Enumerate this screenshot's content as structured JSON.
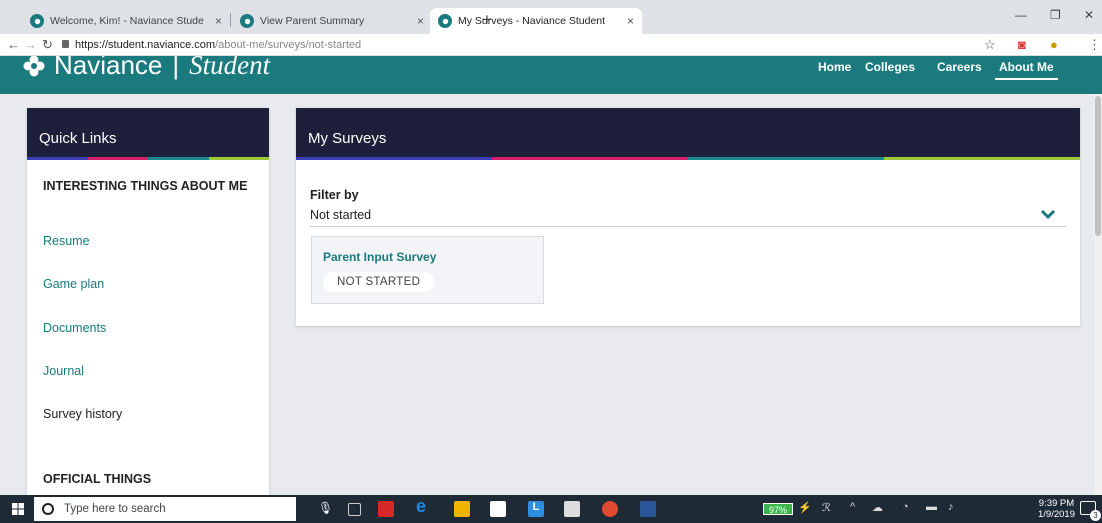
{
  "browser": {
    "tabs": [
      {
        "label": "Welcome, Kim! - Naviance Stude",
        "close": "×"
      },
      {
        "label": "View Parent Summary",
        "close": "×"
      },
      {
        "label": "My Surveys - Naviance Student",
        "close": "×"
      }
    ],
    "new_tab": "+",
    "url_host": "https://student.naviance.com",
    "url_path": "/about-me/surveys/not-started"
  },
  "site": {
    "brand_name": "Naviance",
    "brand_sep": "|",
    "brand_product": "Student",
    "nav": [
      "Home",
      "Colleges",
      "Careers",
      "About Me"
    ],
    "active_nav": "About Me",
    "accent": "#1a7a7e",
    "card_header_bg": "#1d1f3b"
  },
  "sidebar": {
    "title": "Quick Links",
    "section1": "INTERESTING THINGS ABOUT ME",
    "links": [
      "Resume",
      "Game plan",
      "Documents",
      "Journal",
      "Survey history"
    ],
    "section2": "OFFICIAL THINGS"
  },
  "main": {
    "title": "My Surveys",
    "filter_label": "Filter by",
    "filter_value": "Not started",
    "surveys": [
      {
        "title": "Parent Input Survey",
        "status": "NOT STARTED"
      }
    ]
  },
  "taskbar": {
    "search_placeholder": "Type here to search",
    "battery": "97%",
    "time": "9:39 PM",
    "date": "1/9/2019",
    "notification_count": "3"
  }
}
